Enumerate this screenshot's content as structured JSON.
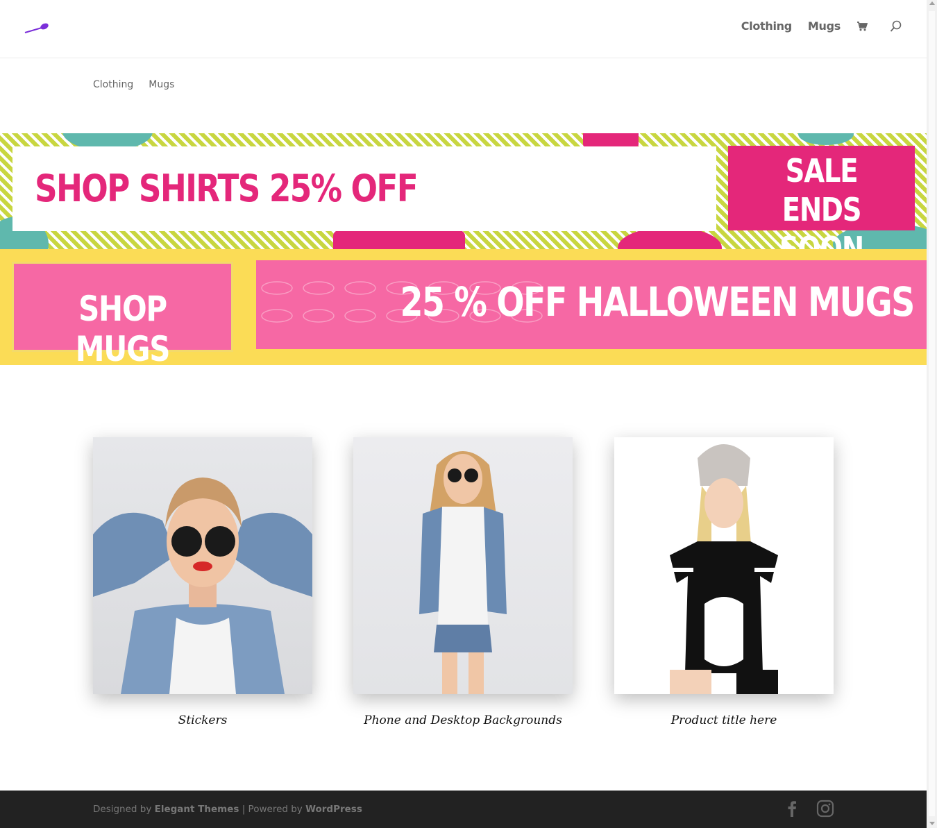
{
  "header": {
    "nav": [
      {
        "label": "Clothing"
      },
      {
        "label": "Mugs"
      }
    ],
    "cart_icon": "shopping-cart-icon",
    "search_icon": "search-icon"
  },
  "submenu": [
    {
      "label": "Clothing"
    },
    {
      "label": "Mugs"
    }
  ],
  "banner_shirts": {
    "headline": "SHOP SHIRTS 25% OFF",
    "badge_line1": "SALE ENDS",
    "badge_line2": "SOON"
  },
  "banner_mugs": {
    "button": "SHOP MUGS",
    "headline": "25 % OFF HALLOWEEN MUGS"
  },
  "products": [
    {
      "title": "Stickers"
    },
    {
      "title": "Phone and Desktop Backgrounds"
    },
    {
      "title": "Product title here"
    }
  ],
  "footer": {
    "designed_by_prefix": "Designed by ",
    "designed_by_link": "Elegant Themes",
    "separator": " | Powered by ",
    "powered_by_link": "WordPress",
    "social": [
      "facebook-icon",
      "instagram-icon"
    ]
  },
  "colors": {
    "accent_pink": "#e4277a",
    "light_pink": "#f668a4",
    "yellow": "#fbdc56",
    "lime": "#c8d640",
    "teal": "#5fb8ad",
    "footer_bg": "#222222",
    "logo_purple": "#7b2fd9"
  }
}
